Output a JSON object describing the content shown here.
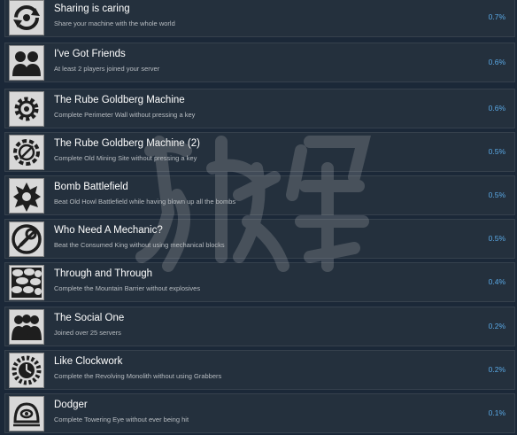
{
  "achievements": [
    {
      "title": "Sharing is caring",
      "description": "Share your machine with the whole world",
      "percent": "0.7%",
      "icon": "share-arrows-icon"
    },
    {
      "title": "I've Got Friends",
      "description": "At least 2 players joined your server",
      "percent": "0.6%",
      "icon": "two-people-icon"
    },
    {
      "title": "The Rube Goldberg Machine",
      "description": "Complete Perimeter Wall without pressing a key",
      "percent": "0.6%",
      "icon": "gear-icon"
    },
    {
      "title": "The Rube Goldberg Machine (2)",
      "description": "Complete Old Mining Site without pressing a key",
      "percent": "0.5%",
      "icon": "gear-outline-icon"
    },
    {
      "title": "Bomb Battlefield",
      "description": "Beat Old Howl Battlefield while having blown up all the bombs",
      "percent": "0.5%",
      "icon": "explosion-icon"
    },
    {
      "title": "Who Need A Mechanic?",
      "description": "Beat the Consumed King without using mechanical blocks",
      "percent": "0.5%",
      "icon": "no-wrench-icon"
    },
    {
      "title": "Through and Through",
      "description": "Complete the Mountain Barrier without explosives",
      "percent": "0.4%",
      "icon": "rock-wall-icon"
    },
    {
      "title": "The Social One",
      "description": "Joined over 25 servers",
      "percent": "0.2%",
      "icon": "group-people-icon"
    },
    {
      "title": "Like Clockwork",
      "description": "Complete the Revolving Monolith without using Grabbers",
      "percent": "0.2%",
      "icon": "clockwork-gear-icon"
    },
    {
      "title": "Dodger",
      "description": "Complete Towering Eye without ever being hit",
      "percent": "0.1%",
      "icon": "eye-creature-icon"
    }
  ]
}
